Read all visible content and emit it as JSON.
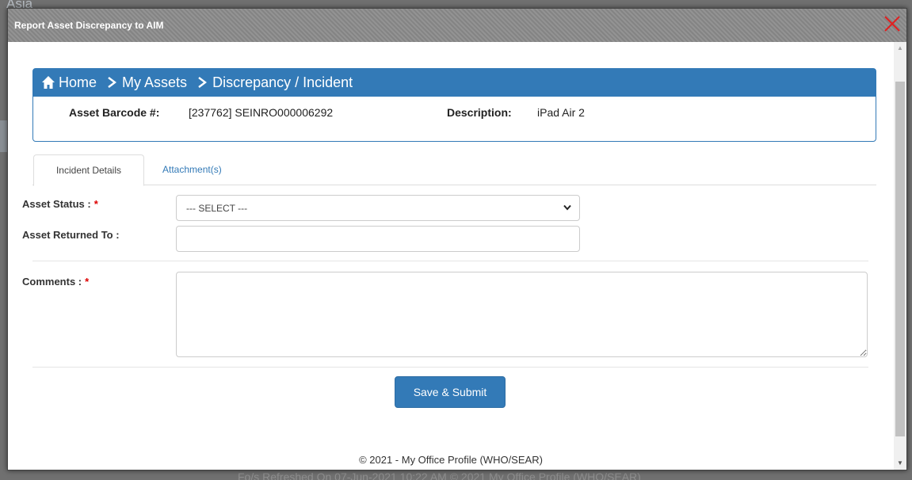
{
  "background": {
    "corner_text": "Asia",
    "footer_text": "Fo/s Refreshed On 07-Jun-2021 10:22 AM © 2021 My Office Profile (WHO/SEAR)"
  },
  "modal": {
    "title": "Report Asset Discrepancy to AIM",
    "close_icon": "close-x-icon"
  },
  "breadcrumb": {
    "home": "Home",
    "my_assets": "My Assets",
    "current": "Discrepancy / Incident"
  },
  "asset": {
    "barcode_label": "Asset Barcode #:",
    "barcode_value": "[237762] SEINRO000006292",
    "description_label": "Description:",
    "description_value": "iPad Air 2"
  },
  "tabs": [
    {
      "label": "Incident Details",
      "active": true
    },
    {
      "label": "Attachment(s)",
      "active": false
    }
  ],
  "form": {
    "asset_status_label": "Asset Status :",
    "asset_status_value": "--- SELECT ---",
    "asset_returned_to_label": "Asset Returned To :",
    "asset_returned_to_value": "",
    "comments_label": "Comments :",
    "comments_value": "",
    "required_marker": "*",
    "submit_label": "Save & Submit"
  },
  "footer": {
    "text": "© 2021 - My Office Profile (WHO/SEAR)"
  },
  "colors": {
    "primary": "#337ab7",
    "required": "#dd0000",
    "close_icon": "#e02020"
  }
}
